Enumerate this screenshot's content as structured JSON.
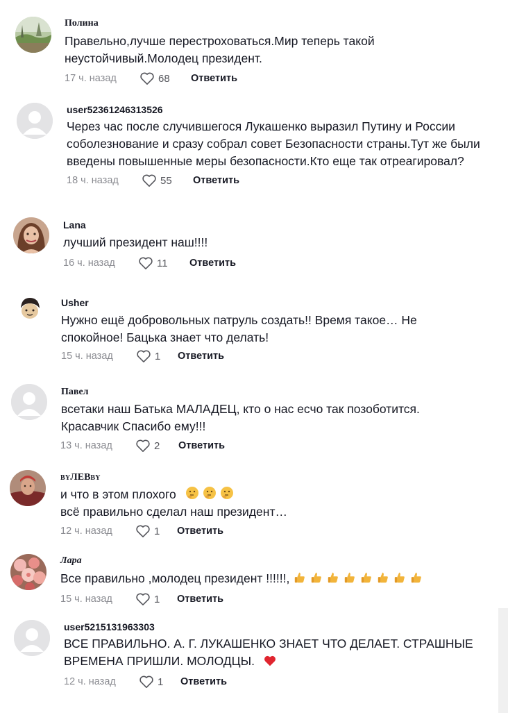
{
  "comments": [
    {
      "username": "Полина",
      "lines": [
        "Правельно,лучше перестроховаться.Мир теперь такой",
        "неустойчивый.Молодец президент."
      ],
      "time": "17 ч. назад",
      "likes": "68",
      "reply": "Ответить",
      "avatar": "landscape-photo"
    },
    {
      "username": "user52361246313526",
      "lines": [
        "Через час после случившегося Лукашенко выразил Путину и России",
        "соболезнование и сразу собрал совет Безопасности страны.Тут же были",
        "введены повышенные меры безопасности.Кто еще так отреагировал?"
      ],
      "time": "18 ч. назад",
      "likes": "55",
      "reply": "Ответить",
      "avatar": "default-avatar"
    },
    {
      "username": "Lana",
      "lines": [
        "лучший президент наш!!!!"
      ],
      "time": "16 ч. назад",
      "likes": "11",
      "reply": "Ответить",
      "avatar": "woman-portrait"
    },
    {
      "username": "Usher",
      "lines": [
        "Нужно ещё добровольных патруль создать!! Время такое… Не",
        "спокойное! Бацька знает что делать!"
      ],
      "time": "15 ч. назад",
      "likes": "1",
      "reply": "Ответить",
      "avatar": "cartoon-face"
    },
    {
      "username": "Павел",
      "lines": [
        "всетаки наш Батька МАЛАДЕЦ, кто о нас есчо так позоботится.",
        "Красавчик Спасибо ему!!!"
      ],
      "time": "13 ч. назад",
      "likes": "2",
      "reply": "Ответить",
      "avatar": "default-avatar"
    },
    {
      "username_prefix": "BY",
      "username_main": "ЛЕВ",
      "username_suffix": "BY",
      "lines": [
        "и что в этом плохого",
        "всё правильно сделал наш президент…"
      ],
      "time": "12 ч. назад",
      "likes": "1",
      "reply": "Ответить",
      "avatar": "man-portrait",
      "emojis": [
        "thinking-face-emoji",
        "thinking-face-emoji",
        "thinking-face-emoji"
      ]
    },
    {
      "username": "Лара",
      "lines": [
        "Все правильно ,молодец президент !!!!!!,"
      ],
      "time": "15 ч. назад",
      "likes": "1",
      "reply": "Ответить",
      "avatar": "flowers-photo",
      "emojis": [
        "thumbs-up-emoji",
        "thumbs-up-emoji",
        "thumbs-up-emoji",
        "thumbs-up-emoji",
        "thumbs-up-emoji",
        "thumbs-up-emoji",
        "thumbs-up-emoji",
        "thumbs-up-emoji"
      ]
    },
    {
      "username": "user5215131963303",
      "lines": [
        "ВСЕ ПРАВИЛЬНО. А. Г. ЛУКАШЕНКО ЗНАЕТ ЧТО ДЕЛАЕТ. СТРАШНЫЕ",
        "ВРЕМЕНА ПРИШЛИ. МОЛОДЦЫ."
      ],
      "time": "12 ч. назад",
      "likes": "1",
      "reply": "Ответить",
      "avatar": "default-avatar",
      "emojis": [
        "red-heart-emoji"
      ]
    }
  ],
  "colors": {
    "text": "#161823",
    "meta": "#8a8b91",
    "avatar_default_bg": "#e3e3e5",
    "avatar_default_fg": "#ffffff"
  }
}
